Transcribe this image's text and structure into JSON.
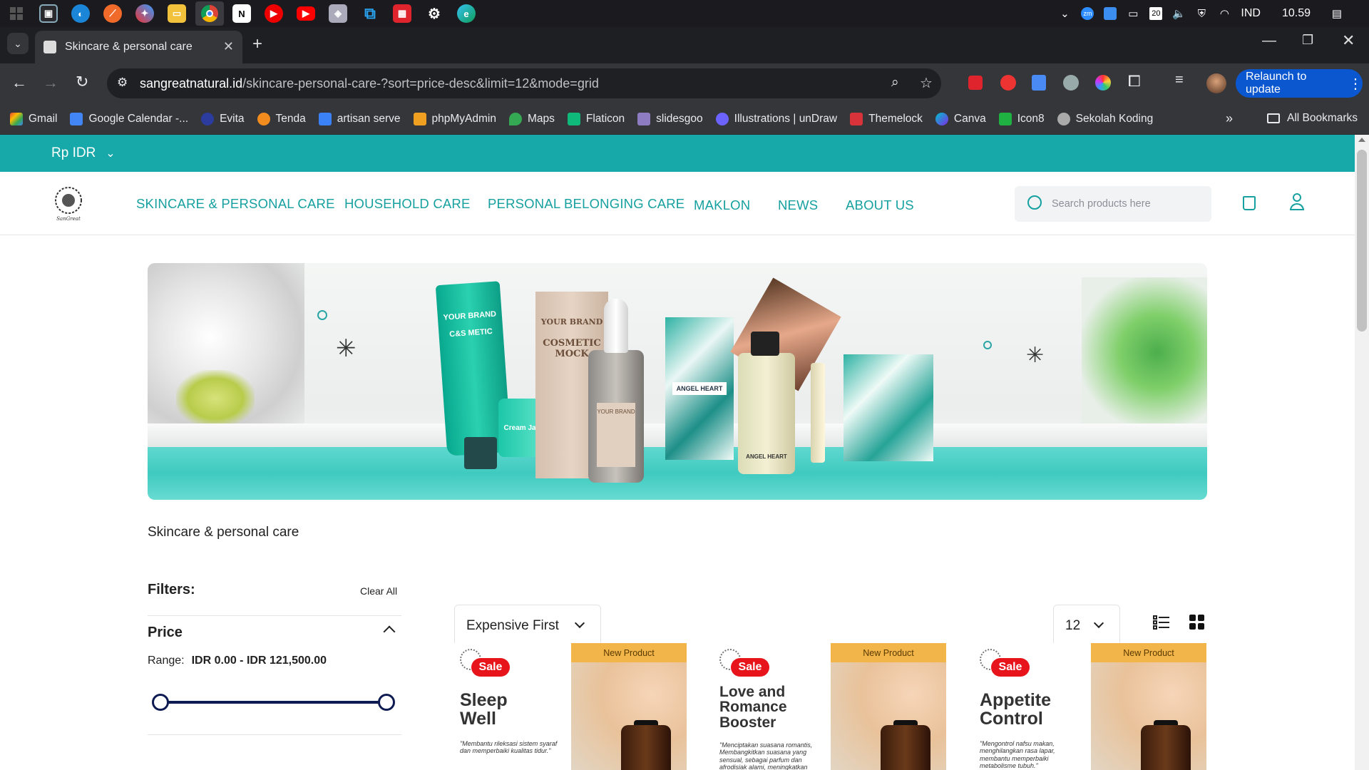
{
  "taskbar": {
    "language": "IND",
    "time": "10.59",
    "battery_level": "20"
  },
  "browser": {
    "tab_title": "Skincare & personal care",
    "url_host": "sangreatnatural.id",
    "url_path": "/skincare-personal-care-?sort=price-desc&limit=12&mode=grid",
    "relaunch_label": "Relaunch to update",
    "bookmarks": [
      "Gmail",
      "Google Calendar -...",
      "Evita",
      "Tenda",
      "artisan serve",
      "phpMyAdmin",
      "Maps",
      "Flaticon",
      "slidesgoo",
      "Illustrations | unDraw",
      "Themelock",
      "Canva",
      "Icon8",
      "Sekolah Koding"
    ],
    "all_bookmarks": "All Bookmarks"
  },
  "site": {
    "currency": "Rp IDR",
    "nav": [
      "SKINCARE & PERSONAL CARE",
      "HOUSEHOLD CARE",
      "PERSONAL BELONGING CARE",
      "MAKLON",
      "NEWS",
      "ABOUT US"
    ],
    "search_placeholder": "Search products here",
    "logo_text": "SanGreat",
    "banner": {
      "tube_label_1": "YOUR BRAND",
      "tube_label_2": "C&S METIC",
      "jar_label": "Cream Jar",
      "box_label_1": "YOUR BRAND",
      "box_label_2": "COSMETIC MOCK",
      "dropper_label": "YOUR BRAND",
      "perfume_box_label": "ANGEL HEART",
      "perfume_bottle_label": "ANGEL HEART"
    },
    "breadcrumb": "Skincare & personal care",
    "filters": {
      "title": "Filters:",
      "clear_all": "Clear All",
      "price_title": "Price",
      "range_label": "Range:",
      "range_value": "IDR 0.00 - IDR 121,500.00"
    },
    "sort": {
      "selected": "Expensive First"
    },
    "limit": {
      "selected": "12"
    },
    "products": [
      {
        "tag": "New Product",
        "sale": "Sale",
        "name_line1": "Sleep",
        "name_line2": "Well",
        "name_line3": "",
        "desc": "\"Membantu rileksasi sistem syaraf dan memperbaiki kualitas tidur.\""
      },
      {
        "tag": "New Product",
        "sale": "Sale",
        "name_line1": "Love and",
        "name_line2": "Romance",
        "name_line3": "Booster",
        "desc": "\"Menciptakan suasana romantis, Membangkitkan suasana yang sensual, sebagai parfum dan afrodisiak alami, meningkatkan"
      },
      {
        "tag": "New Product",
        "sale": "Sale",
        "name_line1": "Appetite",
        "name_line2": "Control",
        "name_line3": "",
        "desc": "\"Mengontrol nafsu makan, menghilangkan rasa lapar, membantu memperbaiki metabolisme tubuh.\""
      }
    ]
  },
  "colors": {
    "brand_teal": "#17a9a9",
    "sale_red": "#e8141b",
    "new_tag": "#f2b54a",
    "slider_navy": "#0e1a52"
  }
}
